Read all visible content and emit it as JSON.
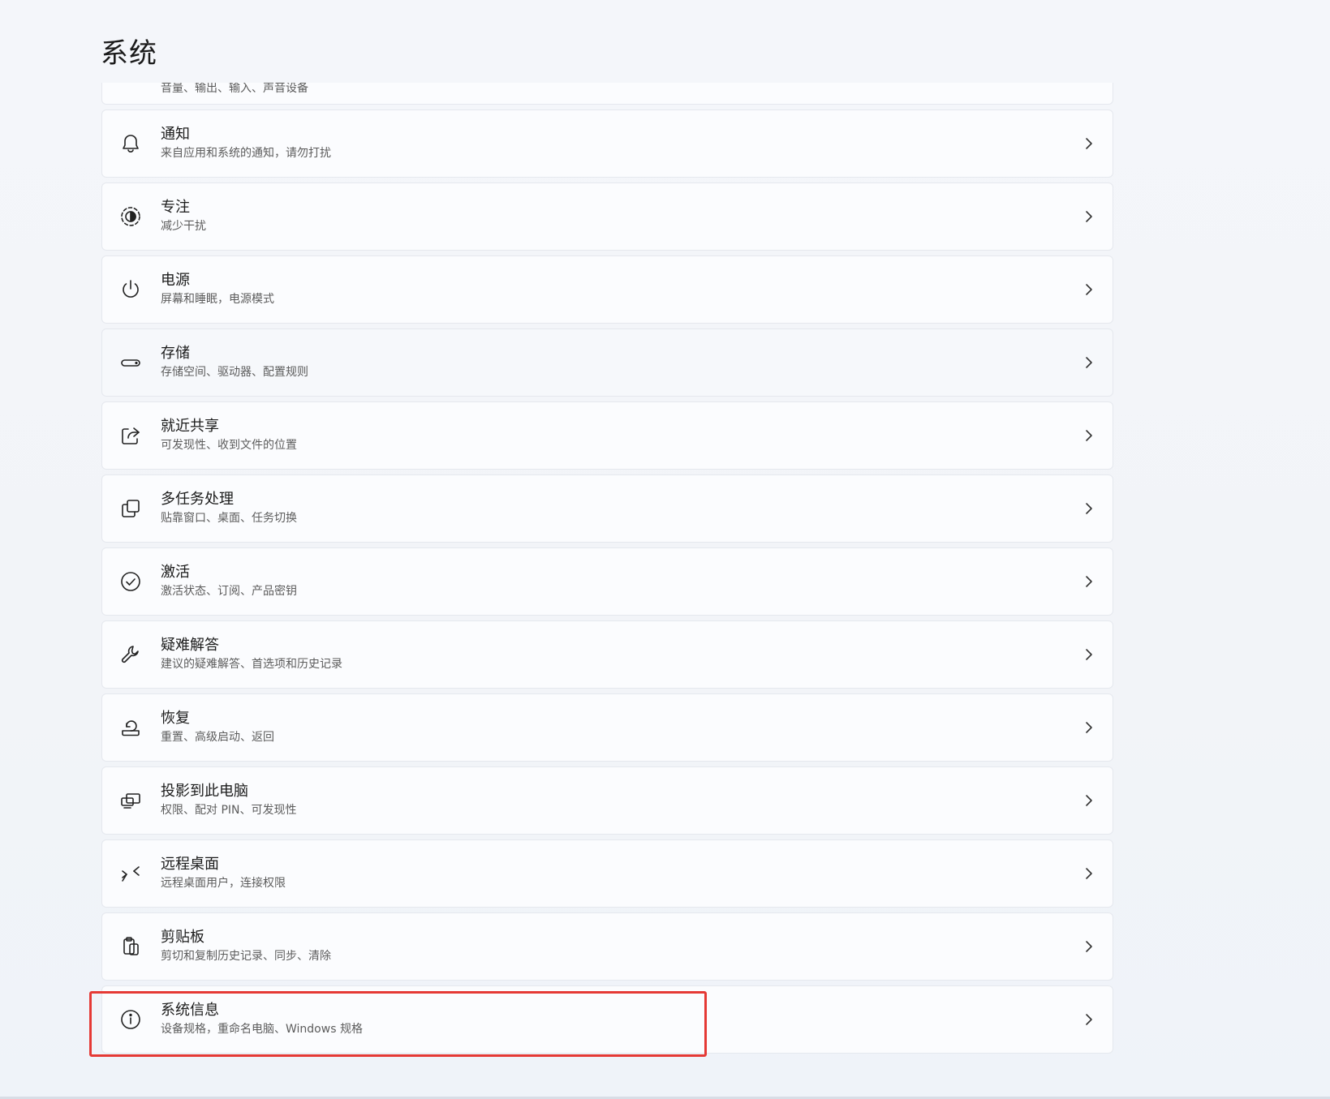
{
  "page": {
    "title": "系统"
  },
  "partial_item": {
    "subtitle": "音量、输出、输入、声音设备"
  },
  "items": [
    {
      "name": "notifications",
      "icon": "bell-icon",
      "title": "通知",
      "subtitle": "来自应用和系统的通知，请勿打扰"
    },
    {
      "name": "focus",
      "icon": "focus-icon",
      "title": "专注",
      "subtitle": "减少干扰"
    },
    {
      "name": "power",
      "icon": "power-icon",
      "title": "电源",
      "subtitle": "屏幕和睡眠，电源模式"
    },
    {
      "name": "storage",
      "icon": "storage-icon",
      "title": "存储",
      "subtitle": "存储空间、驱动器、配置规则"
    },
    {
      "name": "nearby-sharing",
      "icon": "share-icon",
      "title": "就近共享",
      "subtitle": "可发现性、收到文件的位置"
    },
    {
      "name": "multitasking",
      "icon": "multitask-icon",
      "title": "多任务处理",
      "subtitle": "贴靠窗口、桌面、任务切换"
    },
    {
      "name": "activation",
      "icon": "check-circle-icon",
      "title": "激活",
      "subtitle": "激活状态、订阅、产品密钥"
    },
    {
      "name": "troubleshoot",
      "icon": "wrench-icon",
      "title": "疑难解答",
      "subtitle": "建议的疑难解答、首选项和历史记录"
    },
    {
      "name": "recovery",
      "icon": "recovery-icon",
      "title": "恢复",
      "subtitle": "重置、高级启动、返回"
    },
    {
      "name": "projecting",
      "icon": "project-icon",
      "title": "投影到此电脑",
      "subtitle": "权限、配对 PIN、可发现性"
    },
    {
      "name": "remote-desktop",
      "icon": "remote-desktop-icon",
      "title": "远程桌面",
      "subtitle": "远程桌面用户，连接权限"
    },
    {
      "name": "clipboard",
      "icon": "clipboard-icon",
      "title": "剪贴板",
      "subtitle": "剪切和复制历史记录、同步、清除"
    },
    {
      "name": "about",
      "icon": "info-icon",
      "title": "系统信息",
      "subtitle": "设备规格，重命名电脑、Windows 规格"
    }
  ],
  "colors": {
    "highlight": "#e53935",
    "card_bg": "#fbfcfe",
    "page_bg": "#f2f4f8"
  }
}
